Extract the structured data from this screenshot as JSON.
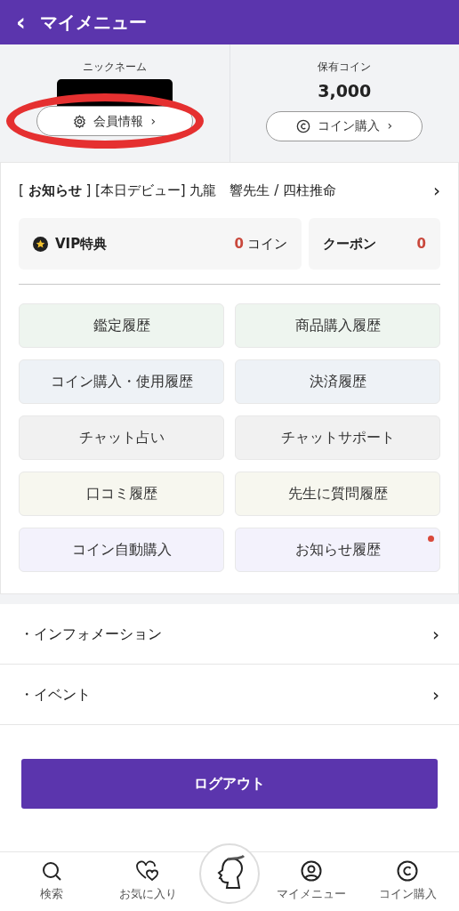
{
  "header": {
    "back": "‹",
    "title": "マイメニュー"
  },
  "profile": {
    "nickname_label": "ニックネーム",
    "nickname_redacted": true,
    "member_button": {
      "label": "会員情報",
      "chevron": "›",
      "circled": true
    },
    "coins_label": "保有コイン",
    "coins": "3,000",
    "buy_button": {
      "label": "コイン購入",
      "chevron": "›"
    }
  },
  "notice": {
    "tag": "[ **お知らせ** ]",
    "text": "[本日デビュー] 九龍　響先生 / 四柱推命",
    "chevron": "›"
  },
  "vip": {
    "label": "VIP特典",
    "count": "0",
    "unit": "コイン"
  },
  "coupon": {
    "label": "クーポン",
    "count": "0"
  },
  "menu": [
    {
      "label": "鑑定履歴",
      "color": "#eef5ef",
      "new": false
    },
    {
      "label": "商品購入履歴",
      "color": "#eef5ef",
      "new": false
    },
    {
      "label": "コイン購入・使用履歴",
      "color": "#eef2f6",
      "new": false
    },
    {
      "label": "決済履歴",
      "color": "#eef2f6",
      "new": false
    },
    {
      "label": "チャット占い",
      "color": "#f1f1f1",
      "new": false
    },
    {
      "label": "チャットサポート",
      "color": "#f1f1f1",
      "new": false
    },
    {
      "label": "口コミ履歴",
      "color": "#f7f7ef",
      "new": false
    },
    {
      "label": "先生に質問履歴",
      "color": "#f7f7ef",
      "new": false
    },
    {
      "label": "コイン自動購入",
      "color": "#f3f2fc",
      "new": false
    },
    {
      "label": "お知らせ履歴",
      "color": "#f3f2fc",
      "new": true
    }
  ],
  "links": [
    {
      "label": "・インフォメーション",
      "chevron": "›"
    },
    {
      "label": "・イベント",
      "chevron": "›"
    }
  ],
  "logout": "ログアウト",
  "bottom_nav": [
    {
      "kind": "search",
      "label": "検索"
    },
    {
      "kind": "hearts",
      "label": "お気に入り"
    },
    {
      "kind": "logo"
    },
    {
      "kind": "person",
      "label": "マイメニュー"
    },
    {
      "kind": "coin",
      "label": "コイン購入"
    }
  ]
}
